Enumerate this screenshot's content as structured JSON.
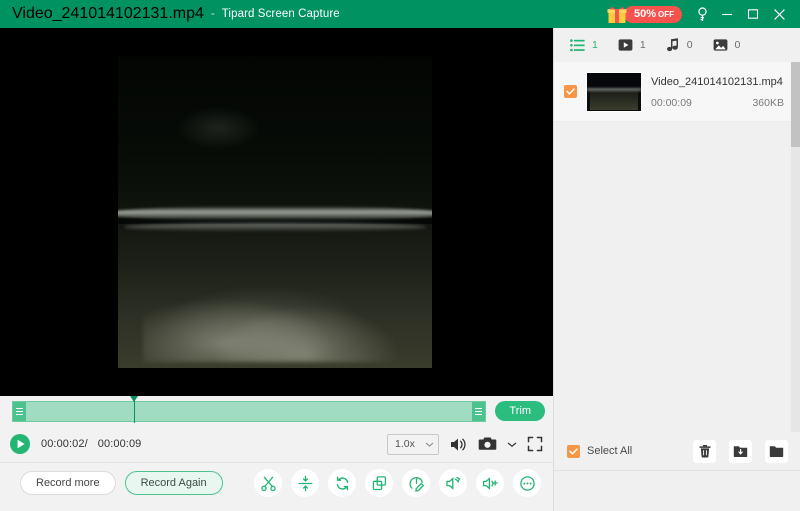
{
  "window": {
    "title_file": "Video_241014102131.mp4",
    "title_separator": "-",
    "title_app": "Tipard Screen Capture",
    "promo_percent": "50%",
    "promo_off": "OFF",
    "gift_icon": "gift-icon",
    "key_icon": "key-icon",
    "minimize_icon": "minimize-icon",
    "maximize_icon": "maximize-icon",
    "close_icon": "close-icon",
    "accent_green": "#009260",
    "promo_red": "#f6534f"
  },
  "player": {
    "trim_button": "Trim",
    "play_icon": "play-icon",
    "current_time": "00:00:02/",
    "total_time": "00:00:09",
    "speed_value": "1.0x",
    "speed_chevron_icon": "chevron-down-icon",
    "volume_icon": "volume-icon",
    "snapshot_icon": "camera-icon",
    "snapshot_chevron_icon": "chevron-down-icon",
    "fullscreen_icon": "fullscreen-icon",
    "trim_handle_left_icon": "trim-handle-icon",
    "trim_handle_right_icon": "trim-handle-icon",
    "playhead_icon": "playhead-marker"
  },
  "bottom": {
    "record_more": "Record more",
    "record_again": "Record Again",
    "tools": [
      {
        "name": "cut-tool",
        "icon": "scissors-icon"
      },
      {
        "name": "compress-tool",
        "icon": "compress-icon"
      },
      {
        "name": "convert-tool",
        "icon": "rotate-icon"
      },
      {
        "name": "merge-tool",
        "icon": "merge-squares-icon"
      },
      {
        "name": "edit-tool",
        "icon": "pencil-circle-icon"
      },
      {
        "name": "audio-extract-tool",
        "icon": "speaker-arrow-icon"
      },
      {
        "name": "volume-boost-tool",
        "icon": "speaker-plus-icon"
      },
      {
        "name": "more-tool",
        "icon": "ellipsis-circle-icon"
      }
    ]
  },
  "right_panel": {
    "tabs": [
      {
        "name": "tab-all",
        "icon": "list-icon",
        "count": "1",
        "active": true
      },
      {
        "name": "tab-video",
        "icon": "video-icon",
        "count": "1",
        "active": false
      },
      {
        "name": "tab-audio",
        "icon": "music-icon",
        "count": "0",
        "active": false
      },
      {
        "name": "tab-image",
        "icon": "image-icon",
        "count": "0",
        "active": false
      }
    ],
    "files": [
      {
        "name": "Video_241014102131.mp4",
        "duration": "00:00:09",
        "size": "360KB",
        "checked": true
      }
    ],
    "select_all_label": "Select All",
    "select_all_checked": true,
    "actions": [
      {
        "name": "delete-button",
        "icon": "trash-icon"
      },
      {
        "name": "save-to-button",
        "icon": "folder-save-icon"
      },
      {
        "name": "open-folder-button",
        "icon": "folder-open-icon"
      }
    ],
    "checkbox_color": "#f79646"
  }
}
